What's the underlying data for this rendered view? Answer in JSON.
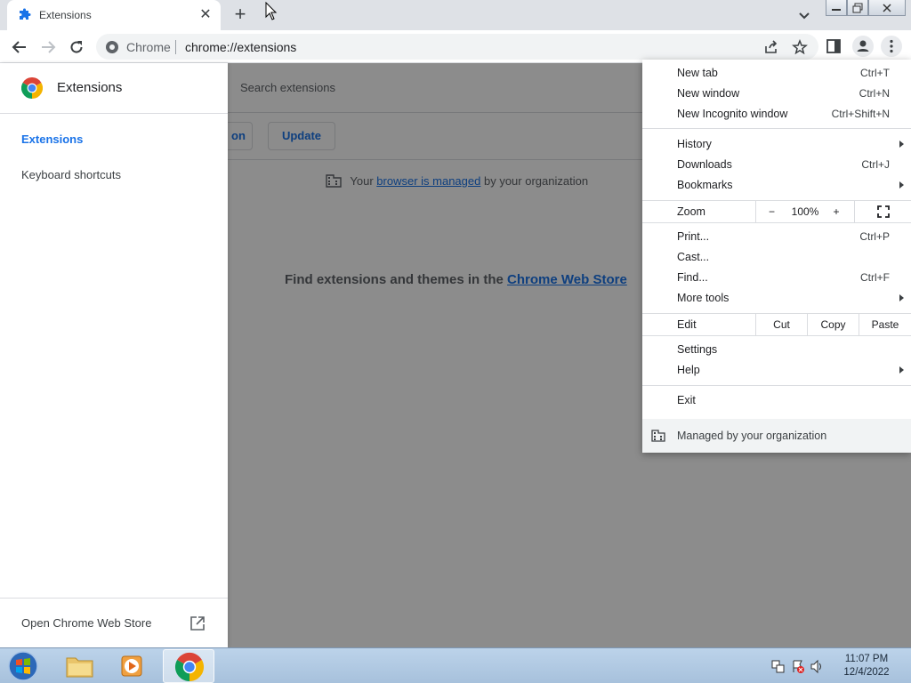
{
  "window": {
    "tab_title": "Extensions",
    "colors": {
      "accent": "#1a73e8",
      "tabstrip": "#dee1e6"
    }
  },
  "toolbar": {
    "omnibox_chip": "Chrome",
    "url": "chrome://extensions"
  },
  "extensions_page": {
    "search_placeholder": "Search extensions",
    "pack_button_partial": "on",
    "update_button": "Update",
    "managed_prefix": "Your",
    "managed_link": "browser is managed",
    "managed_suffix": "by your organization",
    "find_prefix": "Find extensions and themes in the",
    "find_link": "Chrome Web Store"
  },
  "drawer": {
    "title": "Extensions",
    "items": [
      {
        "label": "Extensions",
        "active": true
      },
      {
        "label": "Keyboard shortcuts",
        "active": false
      }
    ],
    "footer_label": "Open Chrome Web Store"
  },
  "menu": {
    "new_tab": {
      "label": "New tab",
      "shortcut": "Ctrl+T"
    },
    "new_window": {
      "label": "New window",
      "shortcut": "Ctrl+N"
    },
    "incognito": {
      "label": "New Incognito window",
      "shortcut": "Ctrl+Shift+N"
    },
    "history": {
      "label": "History"
    },
    "downloads": {
      "label": "Downloads",
      "shortcut": "Ctrl+J"
    },
    "bookmarks": {
      "label": "Bookmarks"
    },
    "zoom": {
      "label": "Zoom",
      "minus": "−",
      "value": "100%",
      "plus": "+"
    },
    "print": {
      "label": "Print...",
      "shortcut": "Ctrl+P"
    },
    "cast": {
      "label": "Cast..."
    },
    "find": {
      "label": "Find...",
      "shortcut": "Ctrl+F"
    },
    "more_tools": {
      "label": "More tools"
    },
    "edit": {
      "label": "Edit",
      "cut": "Cut",
      "copy": "Copy",
      "paste": "Paste"
    },
    "settings": {
      "label": "Settings"
    },
    "help": {
      "label": "Help"
    },
    "exit": {
      "label": "Exit"
    },
    "managed": {
      "label": "Managed by your organization"
    }
  },
  "taskbar": {
    "time": "11:07 PM",
    "date": "12/4/2022",
    "apps": [
      "file-explorer-icon",
      "media-player-icon",
      "chrome-icon"
    ]
  }
}
